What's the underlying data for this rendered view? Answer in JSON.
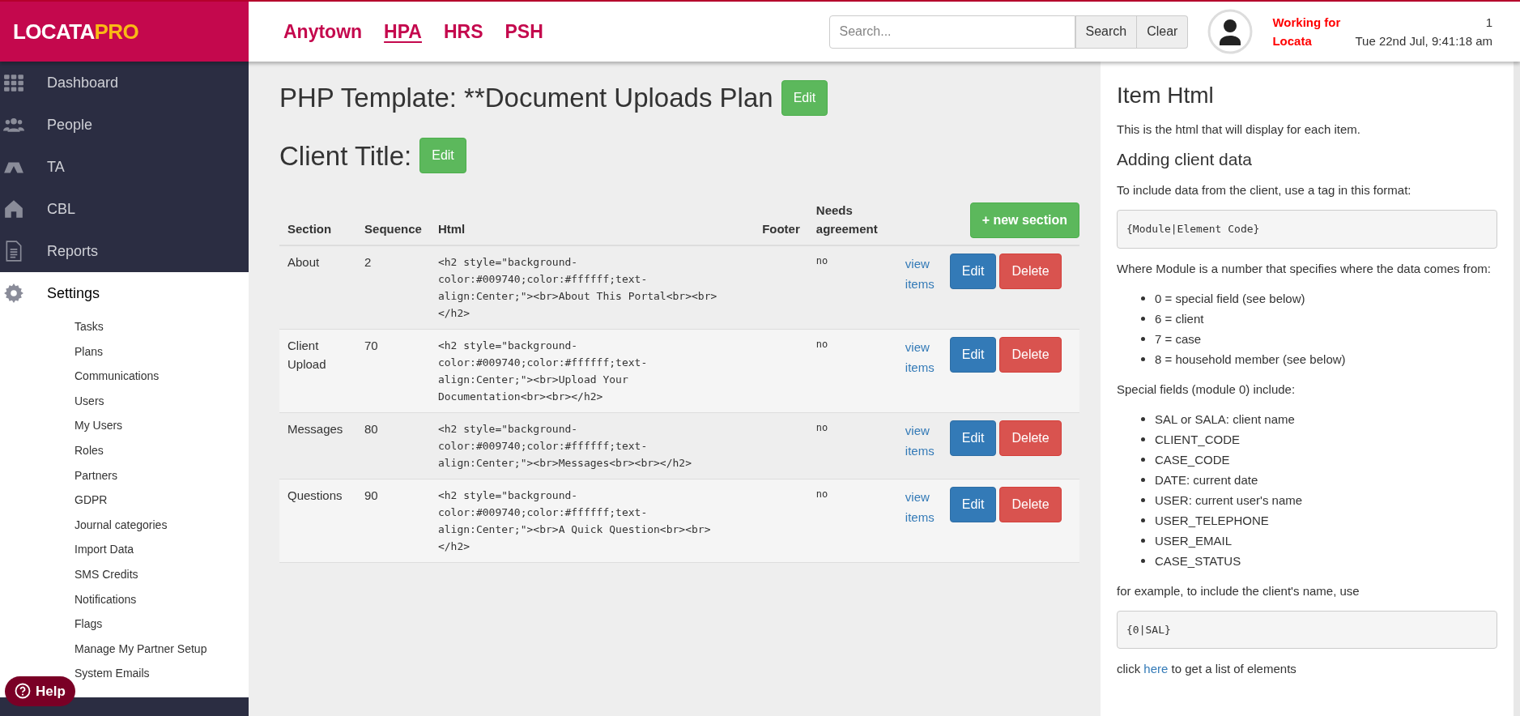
{
  "header": {
    "logo": {
      "part_1": "LOCATA",
      "part_2": "PRO"
    },
    "nav": [
      {
        "label": "Anytown",
        "selected": false
      },
      {
        "label": "HPA",
        "selected": true
      },
      {
        "label": "HRS",
        "selected": false
      },
      {
        "label": "PSH",
        "selected": false
      }
    ],
    "search": {
      "placeholder": "Search...",
      "buttons": [
        "Search",
        "Clear"
      ]
    },
    "user": {
      "working_for": "Working for Locata",
      "count": "1",
      "datetime": "Tue 22nd Jul, 9:41:18 am"
    }
  },
  "sidebar": {
    "items": [
      {
        "label": "Dashboard",
        "selected": false
      },
      {
        "label": "People",
        "selected": false
      },
      {
        "label": "TA",
        "selected": false
      },
      {
        "label": "CBL",
        "selected": false
      },
      {
        "label": "Reports",
        "selected": false
      },
      {
        "label": "Settings",
        "selected": true,
        "children": [
          "Tasks",
          "Plans",
          "Communications",
          "Users",
          "My Users",
          "Roles",
          "Partners",
          "GDPR",
          "Journal categories",
          "Import Data",
          "SMS Credits",
          "Notifications",
          "Flags",
          "Manage My Partner Setup",
          "System Emails"
        ]
      }
    ],
    "help_button": "Help"
  },
  "main": {
    "title": "PHP Template: **Document Uploads Plan",
    "title_button": "Edit",
    "client_title": "Client Title:",
    "client_title_button": "Edit",
    "table": {
      "columns": [
        "Section",
        "Sequence",
        "Html",
        "Footer",
        "Needs agreement"
      ],
      "new_button": "+ new section",
      "rows": [
        {
          "section": "About",
          "sequence": "2",
          "html": "<h2 style=\"background-color:#009740;color:#ffffff;text-align:Center;\"><br>About This Portal<br><br></h2>",
          "agreement": "no",
          "link": "view items",
          "edit": "Edit",
          "delete": "Delete"
        },
        {
          "section": "Client Upload",
          "sequence": "70",
          "html": "<h2 style=\"background-color:#009740;color:#ffffff;text-align:Center;\"><br>Upload Your Documentation<br><br></h2>",
          "agreement": "no",
          "link": "view items",
          "edit": "Edit",
          "delete": "Delete"
        },
        {
          "section": "Messages",
          "sequence": "80",
          "html": "<h2 style=\"background-color:#009740;color:#ffffff;text-align:Center;\"><br>Messages<br><br></h2>",
          "agreement": "no",
          "link": "view items",
          "edit": "Edit",
          "delete": "Delete"
        },
        {
          "section": "Questions",
          "sequence": "90",
          "html": "<h2 style=\"background-color:#009740;color:#ffffff;text-align:Center;\"><br>A Quick Question<br><br></h2>",
          "agreement": "no",
          "link": "view items",
          "edit": "Edit",
          "delete": "Delete"
        }
      ]
    }
  },
  "help_panel": {
    "blocks": [
      {
        "kind": "heading",
        "text": "Item Html"
      },
      {
        "kind": "paragraph",
        "text": "This is the html that will display for each item."
      },
      {
        "kind": "subheading",
        "text": "Adding client data"
      },
      {
        "kind": "paragraph",
        "text": "To include data from the client, use a tag in this format:"
      },
      {
        "kind": "code",
        "text": "{Module|Element Code}"
      },
      {
        "kind": "paragraph",
        "text": "Where Module is a number that specifies where the data comes from:"
      },
      {
        "kind": "list",
        "items": [
          "0 = special field (see below)",
          "6 = client",
          "7 = case",
          "8 = household member (see below)"
        ]
      },
      {
        "kind": "paragraph",
        "text": "Special fields (module 0) include:"
      },
      {
        "kind": "list",
        "items": [
          "SAL or SALA: client name",
          "CLIENT_CODE",
          "CASE_CODE",
          "DATE: current date",
          "USER: current user's name",
          "USER_TELEPHONE",
          "USER_EMAIL",
          "CASE_STATUS"
        ]
      },
      {
        "kind": "paragraph",
        "text": "for example, to include the client's name, use"
      },
      {
        "kind": "code",
        "text": "{0|SAL}"
      },
      {
        "kind": "link_paragraph",
        "before": "click",
        "link": "here",
        "after": "to get a list of elements"
      }
    ]
  }
}
